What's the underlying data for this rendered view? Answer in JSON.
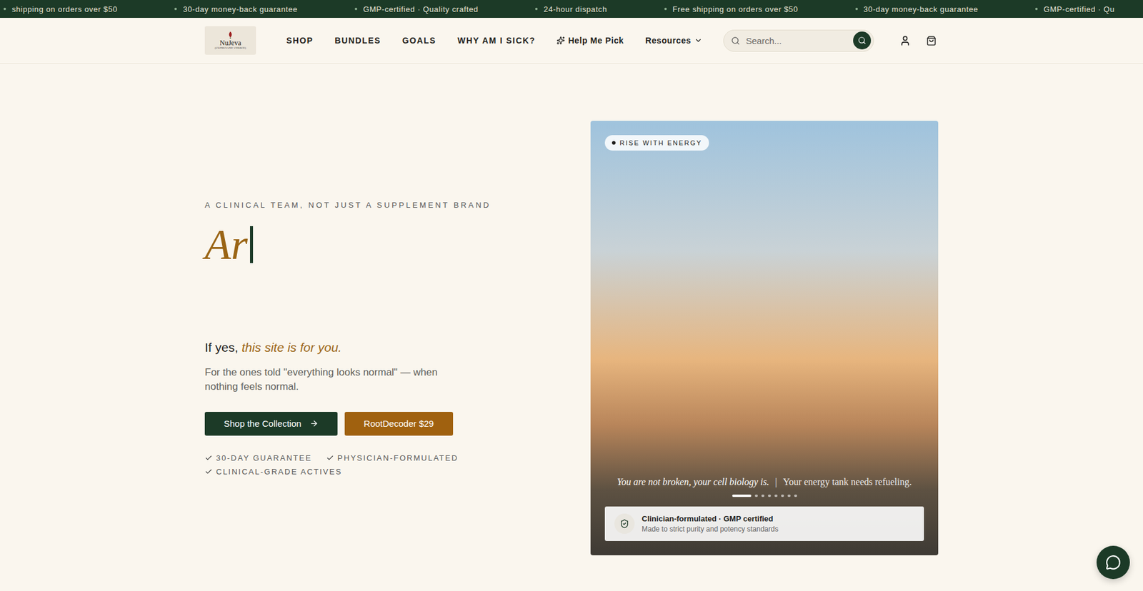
{
  "announcement_bar": {
    "items": [
      "shipping on orders over $50",
      "30-day money-back guarantee",
      "GMP-certified · Quality crafted",
      "24-hour dispatch",
      "Free shipping on orders over $50",
      "30-day money-back guarantee",
      "GMP-certified · Qu"
    ]
  },
  "nav": {
    "logo": {
      "name": "NuJeva",
      "tagline": "(CLINICIANS' CHOICE)"
    },
    "links": [
      {
        "label": "SHOP",
        "kind": "link"
      },
      {
        "label": "BUNDLES",
        "kind": "link"
      },
      {
        "label": "GOALS",
        "kind": "link"
      },
      {
        "label": "WHY AM I SICK?",
        "kind": "link"
      },
      {
        "label": "Help Me Pick",
        "kind": "sparkle"
      },
      {
        "label": "Resources",
        "kind": "dropdown"
      }
    ],
    "search": {
      "placeholder": "Search..."
    }
  },
  "hero": {
    "eyebrow": "A CLINICAL TEAM, NOT JUST A SUPPLEMENT BRAND",
    "headline": "Ar",
    "question": {
      "lead": "If yes,",
      "highlight": "this site is for you."
    },
    "description": "For the ones told \"everything looks normal\" — when nothing feels normal.",
    "buttons": [
      {
        "label": "Shop the Collection",
        "kind": "primary"
      },
      {
        "label": "RootDecoder $29",
        "kind": "accent"
      }
    ],
    "checks": [
      "30-DAY GUARANTEE",
      "PHYSICIAN-FORMULATED",
      "CLINICAL-GRADE ACTIVES"
    ]
  },
  "slide": {
    "badge": "RISE WITH ENERGY",
    "captions": [
      "You are not broken, your cell biology is.",
      "|",
      "Your energy tank needs refueling."
    ],
    "dots": [
      {
        "selected": true
      },
      {
        "selected": false
      },
      {
        "selected": false
      },
      {
        "selected": false
      },
      {
        "selected": false
      },
      {
        "selected": false
      },
      {
        "selected": false
      },
      {
        "selected": false
      }
    ],
    "trust_card": {
      "title": "Clinician-formulated · GMP certified",
      "subtitle": "Made to strict purity and potency standards"
    }
  }
}
